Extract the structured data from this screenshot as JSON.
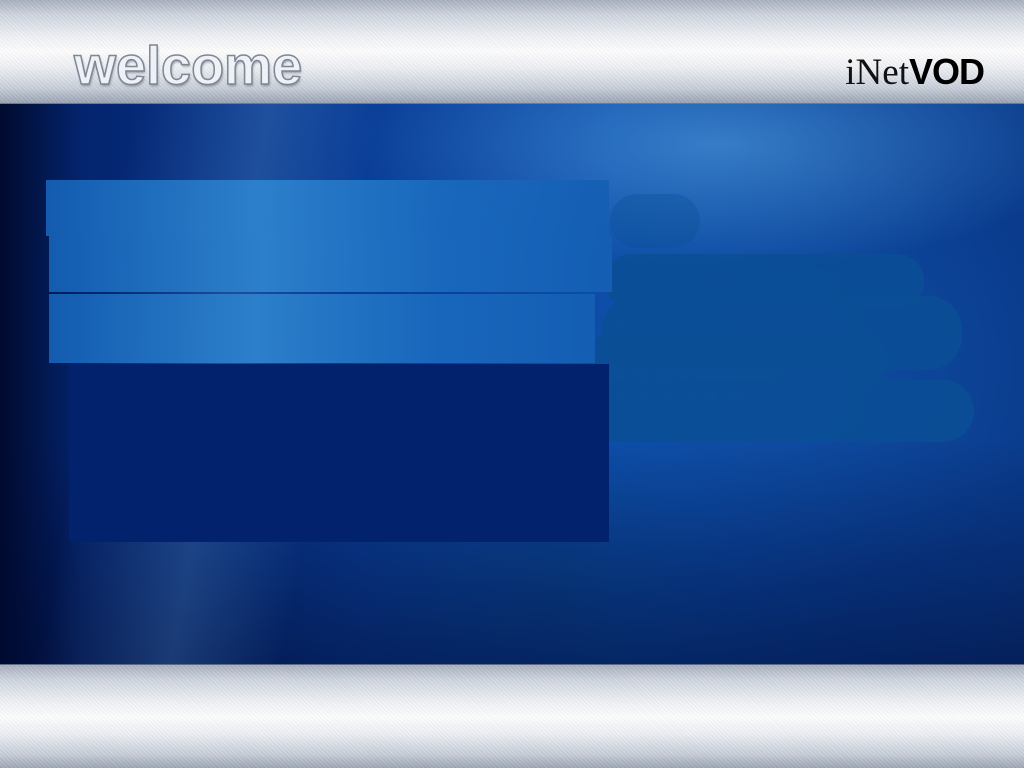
{
  "header": {
    "title": "welcome",
    "brand": {
      "light": "iNet",
      "bold": "VOD"
    }
  },
  "colors": {
    "content_background": "#0a3d96",
    "menu_band": "#1f6fc2",
    "info_panel": "#03226d",
    "header_metal": "#f1f3f7"
  }
}
